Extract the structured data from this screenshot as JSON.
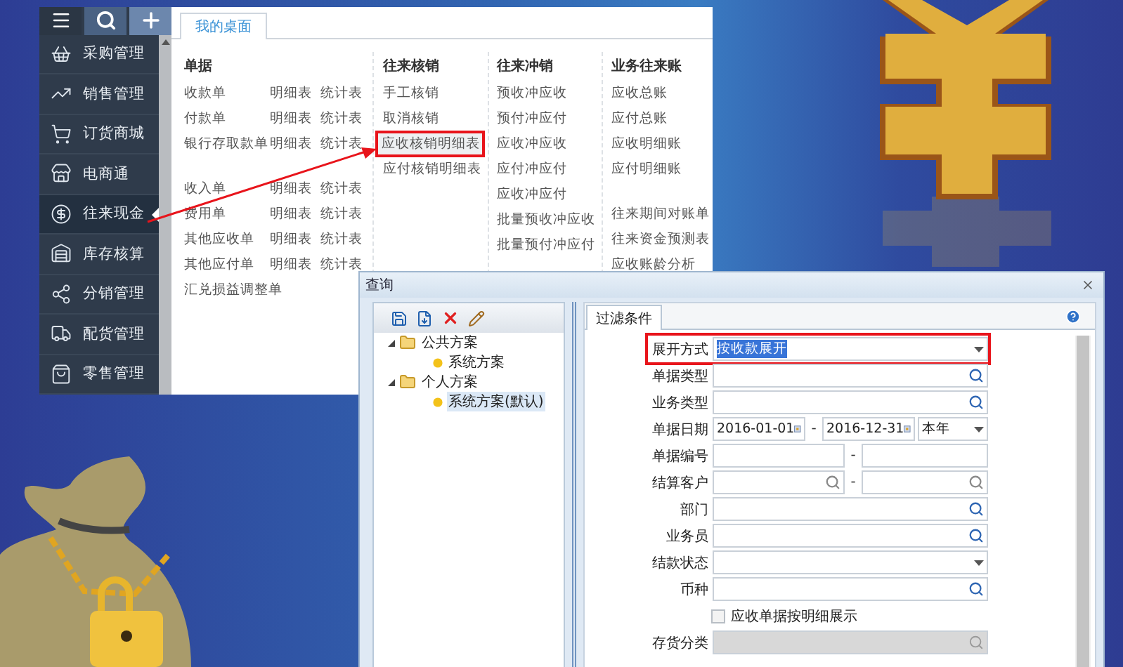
{
  "app_window": {
    "sidebar": {
      "items": [
        {
          "label": "采购管理",
          "selected": false
        },
        {
          "label": "销售管理",
          "selected": false
        },
        {
          "label": "订货商城",
          "selected": false
        },
        {
          "label": "电商通",
          "selected": false
        },
        {
          "label": "往来现金",
          "selected": true
        },
        {
          "label": "库存核算",
          "selected": false
        },
        {
          "label": "分销管理",
          "selected": false
        },
        {
          "label": "配货管理",
          "selected": false
        },
        {
          "label": "零售管理",
          "selected": false
        }
      ]
    },
    "tabs": [
      {
        "label": "我的桌面",
        "selected": true
      }
    ],
    "menu_columns": [
      {
        "heading": "单据",
        "groups": [
          [
            {
              "label": "收款单",
              "links": [
                "明细表",
                "统计表"
              ],
              "highlighted": false
            },
            {
              "label": "付款单",
              "links": [
                "明细表",
                "统计表"
              ],
              "highlighted": false
            },
            {
              "label": "银行存取款单",
              "links": [
                "明细表",
                "统计表"
              ],
              "highlighted": false
            }
          ],
          [
            {
              "label": "收入单",
              "links": [
                "明细表",
                "统计表"
              ],
              "highlighted": false
            },
            {
              "label": "费用单",
              "links": [
                "明细表",
                "统计表"
              ],
              "highlighted": false
            },
            {
              "label": "其他应收单",
              "links": [
                "明细表",
                "统计表"
              ],
              "highlighted": false
            },
            {
              "label": "其他应付单",
              "links": [
                "明细表",
                "统计表"
              ],
              "highlighted": false
            },
            {
              "label": "汇兑损益调整单",
              "highlighted": false
            }
          ]
        ]
      },
      {
        "heading": "往来核销",
        "groups": [
          [
            {
              "label": "手工核销",
              "highlighted": false
            },
            {
              "label": "取消核销",
              "highlighted": false
            },
            {
              "label": "应收核销明细表",
              "highlighted": true
            },
            {
              "label": "应付核销明细表",
              "highlighted": false
            }
          ]
        ]
      },
      {
        "heading": "往来冲销",
        "groups": [
          [
            {
              "label": "预收冲应收",
              "highlighted": false
            },
            {
              "label": "预付冲应付",
              "highlighted": false
            },
            {
              "label": "应收冲应收",
              "highlighted": false
            },
            {
              "label": "应付冲应付",
              "highlighted": false
            },
            {
              "label": "应收冲应付",
              "highlighted": false
            },
            {
              "label": "批量预收冲应收",
              "highlighted": false
            },
            {
              "label": "批量预付冲应付",
              "highlighted": false
            }
          ]
        ]
      },
      {
        "heading": "业务往来账",
        "groups": [
          [
            {
              "label": "应收总账",
              "highlighted": false
            },
            {
              "label": "应付总账",
              "highlighted": false
            },
            {
              "label": "应收明细账",
              "highlighted": false
            },
            {
              "label": "应付明细账",
              "highlighted": false
            }
          ],
          [
            {
              "label": "往来期间对账单",
              "highlighted": false
            },
            {
              "label": "往来资金预测表",
              "highlighted": false
            },
            {
              "label": "应收账龄分析",
              "highlighted": false
            }
          ]
        ]
      }
    ]
  },
  "dialog": {
    "title": "查询",
    "tree": [
      {
        "label": "公共方案",
        "expanded": true,
        "selected": false,
        "children": [
          {
            "label": "系统方案",
            "selected": false
          }
        ]
      },
      {
        "label": "个人方案",
        "expanded": true,
        "selected": false,
        "children": [
          {
            "label": "系统方案(默认)",
            "selected": true
          }
        ]
      }
    ],
    "tabs": [
      {
        "label": "过滤条件",
        "selected": true
      }
    ],
    "fields": [
      {
        "kind": "dropdown",
        "label": "展开方式",
        "value": "按收款展开",
        "value_selected": true,
        "highlighted": true,
        "disabled": false
      },
      {
        "kind": "lookup",
        "label": "单据类型",
        "highlighted": false,
        "disabled": false
      },
      {
        "kind": "lookup",
        "label": "业务类型",
        "highlighted": false,
        "disabled": false
      },
      {
        "kind": "date_range",
        "label": "单据日期",
        "from": "2016-01-01",
        "separator": "-",
        "to": "2016-12-31",
        "period": "本年",
        "highlighted": false,
        "disabled": false
      },
      {
        "kind": "text_range",
        "label": "单据编号",
        "separator": "-",
        "highlighted": false,
        "disabled": false
      },
      {
        "kind": "search_range",
        "label": "结算客户",
        "separator": "-",
        "highlighted": false,
        "disabled": false
      },
      {
        "kind": "lookup",
        "label": "部门",
        "highlighted": false,
        "disabled": false
      },
      {
        "kind": "lookup",
        "label": "业务员",
        "highlighted": false,
        "disabled": false
      },
      {
        "kind": "dropdown",
        "label": "结款状态",
        "highlighted": false,
        "disabled": false
      },
      {
        "kind": "lookup",
        "label": "币种",
        "highlighted": false,
        "disabled": false
      },
      {
        "kind": "checkbox",
        "label": "应收单据按明细展示",
        "checked": false,
        "highlighted": false,
        "disabled": false
      },
      {
        "kind": "lookup",
        "label": "存货分类",
        "highlighted": false,
        "disabled": true
      }
    ]
  }
}
